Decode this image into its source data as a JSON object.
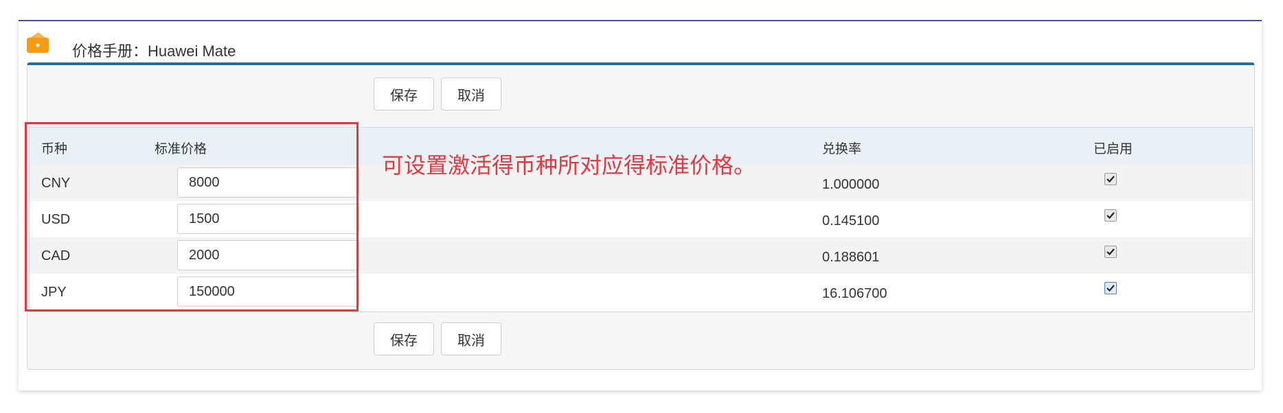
{
  "header": {
    "title": "价格手册：Huawei Mate",
    "icon": "wallet-icon"
  },
  "toolbar": {
    "save_label": "保存",
    "cancel_label": "取消"
  },
  "table": {
    "columns": {
      "currency": "币种",
      "price": "标准价格",
      "rate": "兑换率",
      "enabled": "已启用"
    },
    "rows": [
      {
        "currency": "CNY",
        "price": "8000",
        "rate": "1.000000",
        "enabled": true
      },
      {
        "currency": "USD",
        "price": "1500",
        "rate": "0.145100",
        "enabled": true
      },
      {
        "currency": "CAD",
        "price": "2000",
        "rate": "0.188601",
        "enabled": true
      },
      {
        "currency": "JPY",
        "price": "150000",
        "rate": "16.106700",
        "enabled": true
      }
    ]
  },
  "annotation": {
    "text": "可设置激活得币种所对应得标准价格。"
  },
  "colors": {
    "accent": "#3f51b5",
    "panel_border": "#1f6fa3",
    "annotation": "#e03a40",
    "icon": "#f39c12"
  }
}
